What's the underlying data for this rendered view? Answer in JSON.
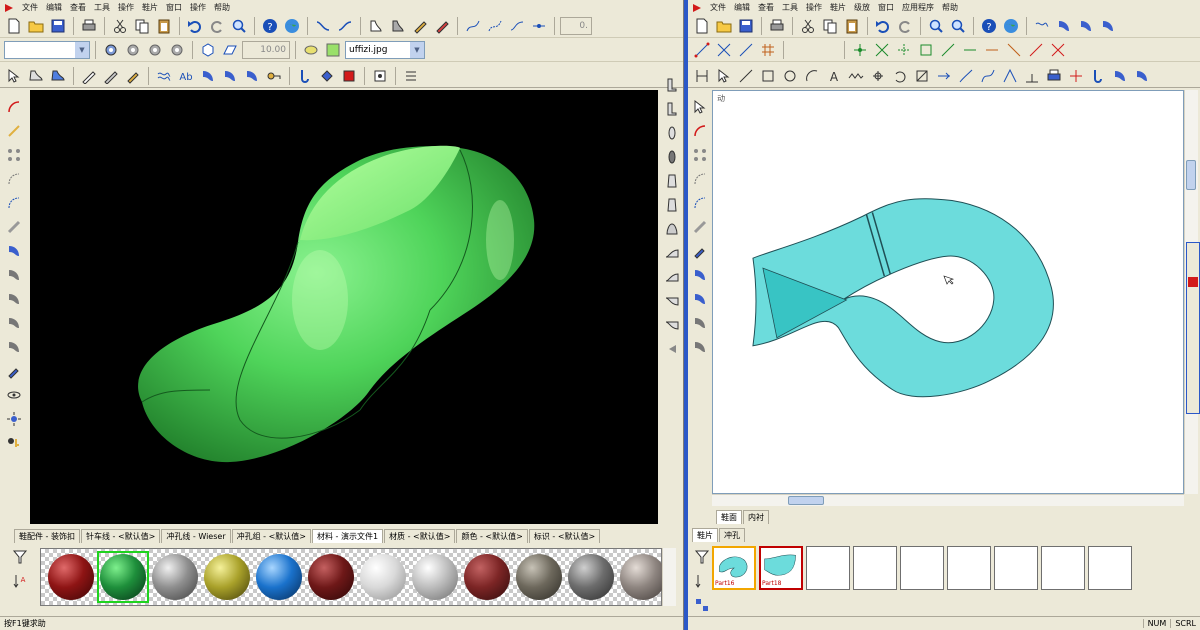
{
  "left_window": {
    "menu": [
      "文件",
      "编辑",
      "查看",
      "工具",
      "操作",
      "鞋片",
      "窗口",
      "操作",
      "帮助"
    ],
    "zoom_value": "0.",
    "thickness_value": "10.00",
    "texture_file": "uffizi.jpg",
    "tabs": [
      {
        "label": "鞋配件 - 装饰扣"
      },
      {
        "label": "针车线 - <默认值>"
      },
      {
        "label": "冲孔线 - Wieser"
      },
      {
        "label": "冲孔组 - <默认值>"
      },
      {
        "label": "材料 - 演示文件1",
        "active": true
      },
      {
        "label": "材质 - <默认值>"
      },
      {
        "label": "颜色 - <默认值>"
      },
      {
        "label": "标识 - <默认值>"
      }
    ],
    "materials": [
      {
        "name": "dark-red",
        "c1": "#e06a6a",
        "c2": "#8e1414",
        "c3": "#3a0505"
      },
      {
        "name": "green",
        "c1": "#7ef08d",
        "c2": "#1e8f3b",
        "c3": "#063016",
        "selected": true
      },
      {
        "name": "grey",
        "c1": "#f0f0f0",
        "c2": "#8f8f8f",
        "c3": "#3e3e3e"
      },
      {
        "name": "olive",
        "c1": "#f5f19a",
        "c2": "#a9a12a",
        "c3": "#3f3b08"
      },
      {
        "name": "blue",
        "c1": "#a8d6ff",
        "c2": "#1a72cc",
        "c3": "#062a55"
      },
      {
        "name": "maroon",
        "c1": "#c46060",
        "c2": "#6e1818",
        "c3": "#2a0606"
      },
      {
        "name": "white",
        "c1": "#ffffff",
        "c2": "#d9d9d9",
        "c3": "#8c8c8c"
      },
      {
        "name": "light-grey",
        "c1": "#ffffff",
        "c2": "#bdbdbd",
        "c3": "#6b6b6b"
      },
      {
        "name": "brick-red",
        "c1": "#c26262",
        "c2": "#7c2525",
        "c3": "#2e0b0b"
      },
      {
        "name": "taupe",
        "c1": "#c7c2b6",
        "c2": "#6d685c",
        "c3": "#2c2a24"
      },
      {
        "name": "stone",
        "c1": "#cfcfcf",
        "c2": "#6d6d6d",
        "c3": "#2b2b2b"
      },
      {
        "name": "warm-grey",
        "c1": "#e4dcd6",
        "c2": "#8e8580",
        "c3": "#3f3936"
      }
    ],
    "status_text": "按F1键求助"
  },
  "right_window": {
    "menu": [
      "文件",
      "编辑",
      "查看",
      "工具",
      "操作",
      "鞋片",
      "级放",
      "窗口",
      "应用程序",
      "帮助"
    ],
    "canvas_corner_label": "动",
    "sheet_tabs": [
      "鞋面",
      "内衬"
    ],
    "panel_tabs": [
      "鞋片",
      "冲孔"
    ],
    "pieces": [
      {
        "label": "Part16",
        "state": "selected-orange"
      },
      {
        "label": "Part18",
        "state": "selected-red"
      },
      {
        "label": ""
      },
      {
        "label": ""
      },
      {
        "label": ""
      },
      {
        "label": ""
      },
      {
        "label": ""
      },
      {
        "label": ""
      },
      {
        "label": ""
      }
    ],
    "status_num": "NUM",
    "status_scrl": "SCRL"
  },
  "colors": {
    "shoe_green": "#4fd45a",
    "pattern_cyan": "#6cdcdc",
    "title_blue": "#2b58c8"
  }
}
